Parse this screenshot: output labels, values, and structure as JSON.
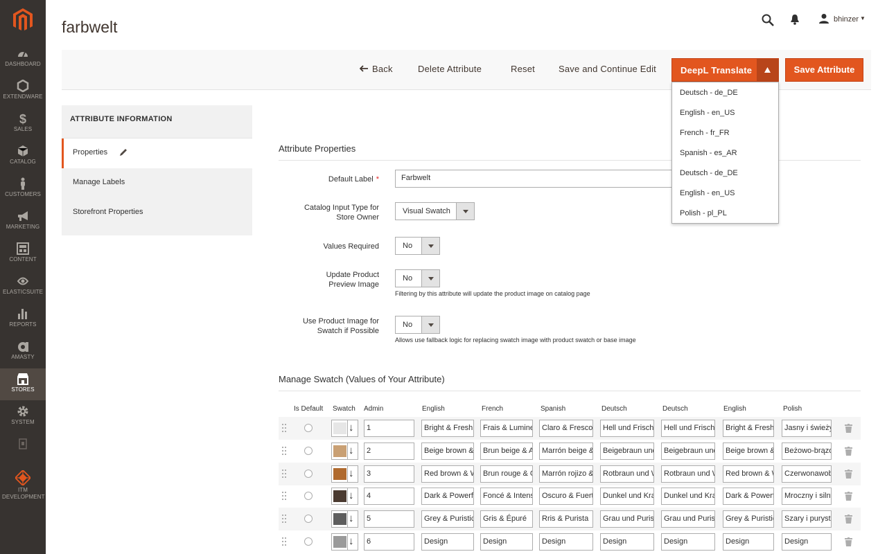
{
  "sidebar": {
    "items": [
      {
        "label": "Dashboard",
        "icon": "dashboard-icon"
      },
      {
        "label": "Extendware",
        "icon": "hexagon-icon"
      },
      {
        "label": "Sales",
        "icon": "dollar-icon"
      },
      {
        "label": "Catalog",
        "icon": "box-icon"
      },
      {
        "label": "Customers",
        "icon": "person-icon"
      },
      {
        "label": "Marketing",
        "icon": "megaphone-icon"
      },
      {
        "label": "Content",
        "icon": "layout-icon"
      },
      {
        "label": "ElasticSuite",
        "icon": "elasticsuite-icon"
      },
      {
        "label": "Reports",
        "icon": "bar-chart-icon"
      },
      {
        "label": "Amasty",
        "icon": "amasty-icon"
      },
      {
        "label": "Stores",
        "icon": "store-icon"
      },
      {
        "label": "System",
        "icon": "gear-icon"
      },
      {
        "label": "",
        "icon": "extension-icon"
      },
      {
        "label": "ITM Development",
        "icon": "itm-logo-icon"
      }
    ]
  },
  "header": {
    "title": "farbwelt",
    "user": "bhinzer"
  },
  "toolbar": {
    "back": "Back",
    "delete": "Delete Attribute",
    "reset": "Reset",
    "save_continue": "Save and Continue Edit",
    "deepl": "DeepL Translate",
    "save": "Save Attribute",
    "deepl_options": [
      "Deutsch - de_DE",
      "English - en_US",
      "French - fr_FR",
      "Spanish - es_AR",
      "Deutsch - de_DE",
      "English - en_US",
      "Polish - pl_PL"
    ]
  },
  "tabs": {
    "heading": "ATTRIBUTE INFORMATION",
    "items": [
      "Properties",
      "Manage Labels",
      "Storefront Properties"
    ]
  },
  "form": {
    "section_title": "Attribute Properties",
    "default_label": {
      "label": "Default Label",
      "value": "Farbwelt"
    },
    "catalog_input": {
      "label_1": "Catalog Input Type for",
      "label_2": "Store Owner",
      "value": "Visual Swatch"
    },
    "values_required": {
      "label": "Values Required",
      "value": "No"
    },
    "update_preview": {
      "label_1": "Update Product",
      "label_2": "Preview Image",
      "value": "No",
      "note": "Filtering by this attribute will update the product image on catalog page"
    },
    "use_product_image": {
      "label_1": "Use Product Image for",
      "label_2": "Swatch if Possible",
      "value": "No",
      "note": "Allows use fallback logic for replacing swatch image with product swatch or base image"
    }
  },
  "swatch": {
    "title": "Manage Swatch (Values of Your Attribute)",
    "headers": [
      "Is Default",
      "Swatch",
      "Admin",
      "English",
      "French",
      "Spanish",
      "Deutsch",
      "Deutsch",
      "English",
      "Polish"
    ],
    "rows": [
      {
        "color": "#e6e6e6",
        "cells": [
          "1",
          "Bright & Fresh",
          "Frais & Lumineux",
          "Claro & Fresco",
          "Hell und Frisch",
          "Hell und Frisch",
          "Bright & Fresh",
          "Jasny i świeży"
        ]
      },
      {
        "color": "#c9a074",
        "cells": [
          "2",
          "Beige brown & A",
          "Brun beige & A",
          "Marrón beige &",
          "Beigebraun und",
          "Beigebraun und",
          "Beige brown &",
          "Beżowo-brązo"
        ]
      },
      {
        "color": "#b06a2e",
        "cells": [
          "3",
          "Red brown & W",
          "Brun rouge & C",
          "Marrón rojizo &",
          "Rotbraun und W",
          "Rotbraun und W",
          "Red brown & W",
          "Czerwonawob"
        ]
      },
      {
        "color": "#4a3a30",
        "cells": [
          "4",
          "Dark & Powerf",
          "Foncé & Intens",
          "Oscuro & Fuert",
          "Dunkel und Kra",
          "Dunkel und Kra",
          "Dark & Powerf",
          "Mroczny i silny"
        ]
      },
      {
        "color": "#5e5e5e",
        "cells": [
          "5",
          "Grey & Puristic",
          "Gris & Épuré",
          "Rris & Purista",
          "Grau und Puris",
          "Grau und Puris",
          "Grey & Puristic",
          "Szary i purysta"
        ]
      },
      {
        "color": "#9a9a9a",
        "cells": [
          "6",
          "Design",
          "Design",
          "Design",
          "Design",
          "Design",
          "Design",
          "Design"
        ]
      }
    ]
  },
  "colors": {
    "accent": "#e2561f",
    "sidebar": "#373330",
    "sidebar_active": "#514943"
  }
}
